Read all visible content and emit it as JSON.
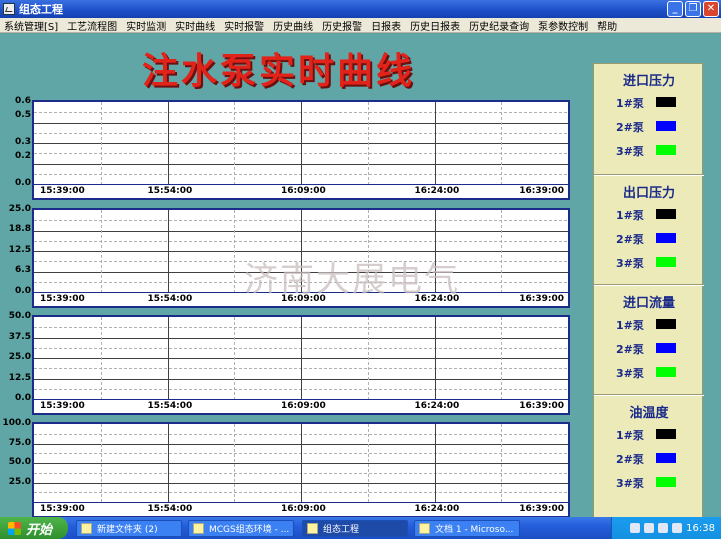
{
  "window": {
    "title": "组态工程"
  },
  "menu": [
    "系统管理[S]",
    "工艺流程图",
    "实时监测",
    "实时曲线",
    "实时报警",
    "历史曲线",
    "历史报警",
    "日报表",
    "历史日报表",
    "历史纪录查询",
    "泵参数控制",
    "帮助"
  ],
  "page_title": "注水泵实时曲线",
  "watermark": "济南大展电气",
  "x_ticks": [
    "15:39:00",
    "15:54:00",
    "16:09:00",
    "16:24:00",
    "16:39:00"
  ],
  "chart_data": [
    {
      "type": "line",
      "title": "进口压力",
      "x": [
        "15:39:00",
        "15:54:00",
        "16:09:00",
        "16:24:00",
        "16:39:00"
      ],
      "ylim": [
        0.0,
        0.6
      ],
      "y_ticks": [
        "0.6",
        "0.5",
        "0.3",
        "0.2",
        "0.0"
      ],
      "series": []
    },
    {
      "type": "line",
      "title": "出口压力",
      "x": [
        "15:39:00",
        "15:54:00",
        "16:09:00",
        "16:24:00",
        "16:39:00"
      ],
      "ylim": [
        0.0,
        25.0
      ],
      "y_ticks": [
        "25.0",
        "18.8",
        "12.5",
        "6.3",
        "0.0"
      ],
      "series": []
    },
    {
      "type": "line",
      "title": "进口流量",
      "x": [
        "15:39:00",
        "15:54:00",
        "16:09:00",
        "16:24:00",
        "16:39:00"
      ],
      "ylim": [
        0.0,
        50.0
      ],
      "y_ticks": [
        "50.0",
        "37.5",
        "25.0",
        "12.5",
        "0.0"
      ],
      "series": []
    },
    {
      "type": "line",
      "title": "油温度",
      "x": [
        "15:39:00",
        "15:54:00",
        "16:09:00",
        "16:24:00",
        "16:39:00"
      ],
      "ylim": [
        0.0,
        100.0
      ],
      "y_ticks": [
        "100.0",
        "75.0",
        "50.0",
        "25.0"
      ],
      "series": []
    }
  ],
  "legend": [
    {
      "title": "进口压力",
      "items": [
        {
          "label": "1#泵",
          "color": "#000000"
        },
        {
          "label": "2#泵",
          "color": "#0000ff"
        },
        {
          "label": "3#泵",
          "color": "#00ff00"
        }
      ]
    },
    {
      "title": "出口压力",
      "items": [
        {
          "label": "1#泵",
          "color": "#000000"
        },
        {
          "label": "2#泵",
          "color": "#0000ff"
        },
        {
          "label": "3#泵",
          "color": "#00ff00"
        }
      ]
    },
    {
      "title": "进口流量",
      "items": [
        {
          "label": "1#泵",
          "color": "#000000"
        },
        {
          "label": "2#泵",
          "color": "#0000ff"
        },
        {
          "label": "3#泵",
          "color": "#00ff00"
        }
      ]
    },
    {
      "title": "油温度",
      "items": [
        {
          "label": "1#泵",
          "color": "#000000"
        },
        {
          "label": "2#泵",
          "color": "#0000ff"
        },
        {
          "label": "3#泵",
          "color": "#00ff00"
        }
      ]
    }
  ],
  "taskbar": {
    "start_label": "开始",
    "items": [
      "新建文件夹 (2)",
      "MCGS组态环境 - ...",
      "组态工程",
      "文档 1 - Microso..."
    ],
    "clock": "16:38"
  },
  "colors": {
    "title_red": "#e2231a",
    "panel_border": "#1c2c8a",
    "legend_bg": "#eceab8",
    "background": "#60a6a6"
  }
}
